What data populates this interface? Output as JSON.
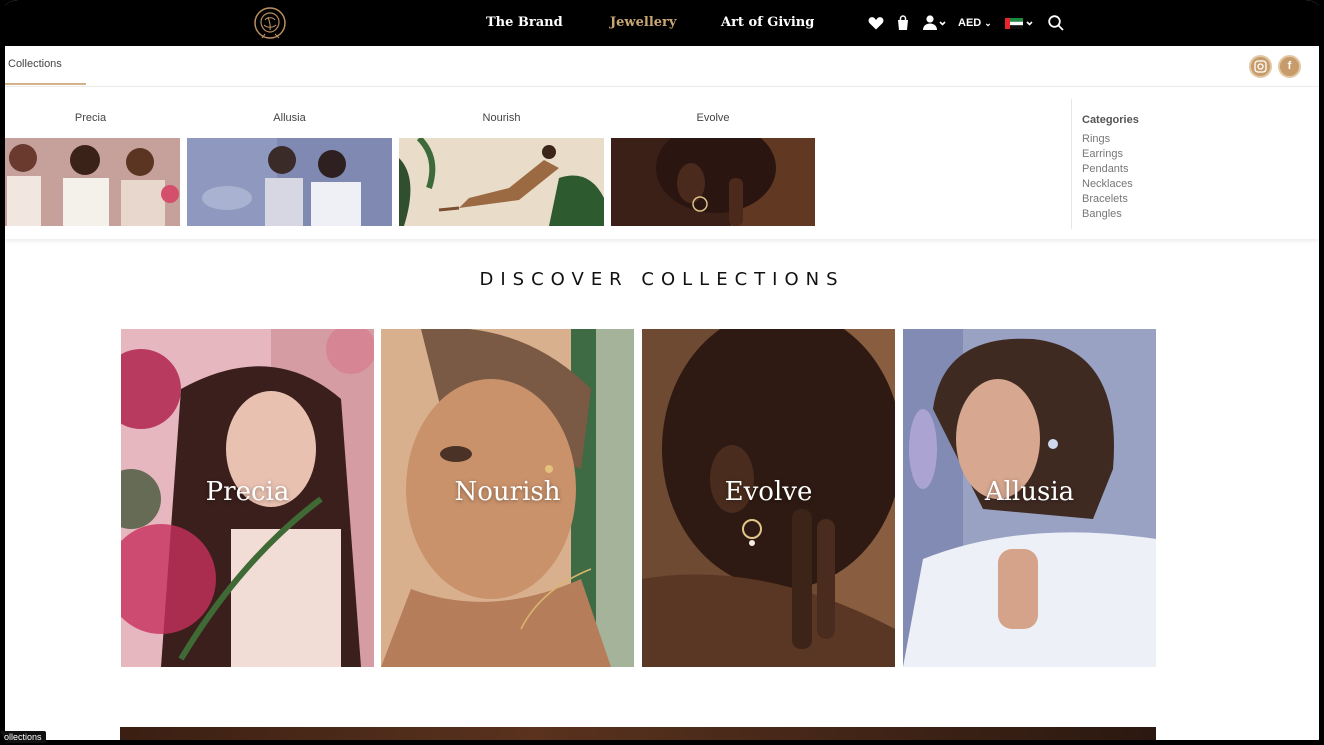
{
  "nav": {
    "links": [
      "The Brand",
      "Jewellery",
      "Art of Giving"
    ],
    "active": "Jewellery",
    "currency": "AED",
    "accent": "#c9a774"
  },
  "icons": [
    "rose-logo-icon",
    "heart-icon",
    "bag-icon",
    "user-icon",
    "uae-flag-icon",
    "search-icon",
    "instagram-icon",
    "facebook-icon"
  ],
  "subbar": {
    "tab": "Collections",
    "social": [
      "instagram",
      "facebook"
    ]
  },
  "mega": {
    "collections": [
      "Precia",
      "Allusia",
      "Nourish",
      "Evolve"
    ],
    "categories_title": "Categories",
    "categories": [
      "Rings",
      "Earrings",
      "Pendants",
      "Necklaces",
      "Bracelets",
      "Bangles"
    ]
  },
  "section": {
    "heading": "DISCOVER COLLECTIONS",
    "cards": [
      "Precia",
      "Nourish",
      "Evolve",
      "Allusia"
    ]
  },
  "status": {
    "tooltip": "ollections"
  }
}
